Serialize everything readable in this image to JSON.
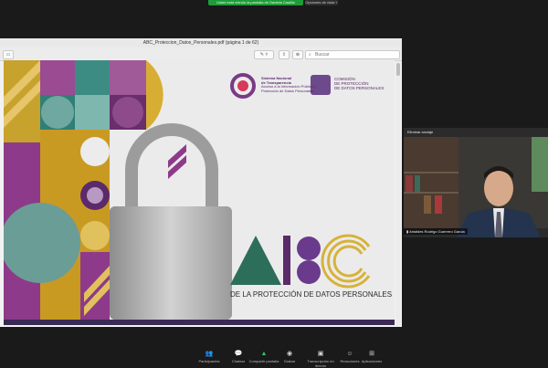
{
  "share_banner": {
    "text": "Usted está viendo la pantalla de Daniela Castillo"
  },
  "view_options": {
    "label": "Opciones de vista ˅"
  },
  "pdf": {
    "title": "ABC_Proteccion_Datos_Personales.pdf (página 1 de 62)",
    "search_placeholder": "Buscar"
  },
  "slide": {
    "org1_line1": "Sistema Nacional",
    "org1_line2": "de Transparencia",
    "org1_line3": "Acceso a la Información Pública y",
    "org1_line4": "Protección de Datos Personales",
    "org2_line1": "COMISIÓN",
    "org2_line2": "DE PROTECCIÓN",
    "org2_line3": "DE DATOS PERSONALES",
    "abc_subtitle": "DE LA PROTECCIÓN DE DATOS PERSONALES"
  },
  "participant": {
    "stop_pin_label": "Eliminar anclaje",
    "name": "Aristides Rodrigo Guerrero García"
  },
  "controls": [
    {
      "label": "Participantes",
      "icon": "participants-icon"
    },
    {
      "label": "Chatear",
      "icon": "chat-icon"
    },
    {
      "label": "Compartir pantalla",
      "icon": "share-screen-icon"
    },
    {
      "label": "Grabar",
      "icon": "record-icon"
    },
    {
      "label": "Transcripción en directo",
      "icon": "cc-icon"
    },
    {
      "label": "Reacciones",
      "icon": "reactions-icon"
    },
    {
      "label": "Aplicaciones",
      "icon": "apps-icon"
    }
  ],
  "colors": {
    "share_green": "#1f9c3a",
    "accent_purple": "#8e3a8a",
    "gold": "#d3a92c",
    "teal": "#2f8a83"
  }
}
